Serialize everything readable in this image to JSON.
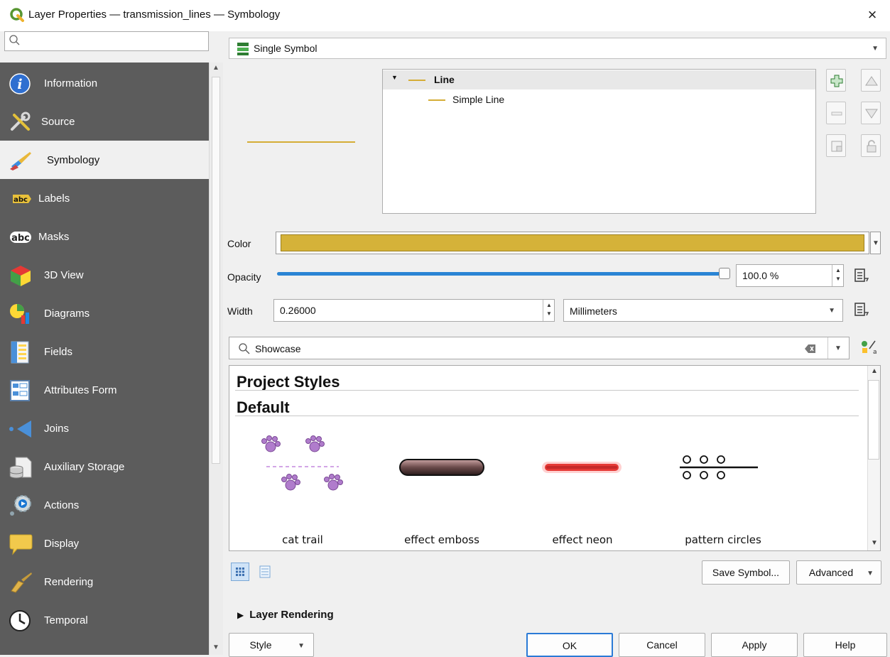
{
  "window": {
    "title": "Layer Properties — transmission_lines — Symbology",
    "close_glyph": "×"
  },
  "sidebar": {
    "search_placeholder": "",
    "items": [
      {
        "label": "Information",
        "icon": "information-icon"
      },
      {
        "label": "Source",
        "icon": "source-tools-icon"
      },
      {
        "label": "Symbology",
        "icon": "paintbrush-icon",
        "active": true
      },
      {
        "label": "Labels",
        "icon": "labels-abc-icon"
      },
      {
        "label": "Masks",
        "icon": "masks-abc-icon"
      },
      {
        "label": "3D View",
        "icon": "cube-3d-icon"
      },
      {
        "label": "Diagrams",
        "icon": "diagrams-icon"
      },
      {
        "label": "Fields",
        "icon": "fields-icon"
      },
      {
        "label": "Attributes Form",
        "icon": "attributes-form-icon"
      },
      {
        "label": "Joins",
        "icon": "joins-icon"
      },
      {
        "label": "Auxiliary Storage",
        "icon": "auxiliary-storage-icon"
      },
      {
        "label": "Actions",
        "icon": "actions-gear-icon"
      },
      {
        "label": "Display",
        "icon": "display-speech-bubble-icon"
      },
      {
        "label": "Rendering",
        "icon": "rendering-brush-icon"
      },
      {
        "label": "Temporal",
        "icon": "temporal-clock-icon"
      }
    ]
  },
  "renderer": {
    "selected": "Single Symbol"
  },
  "symbol_tree": {
    "root": "Line",
    "child": "Simple Line"
  },
  "form": {
    "color_label": "Color",
    "color_value": "#d5b239",
    "opacity_label": "Opacity",
    "opacity_value": "100.0 %",
    "opacity_fraction": 1.0,
    "width_label": "Width",
    "width_value": "0.26000",
    "width_units": "Millimeters"
  },
  "style_search": {
    "value": "Showcase"
  },
  "symbol_library": {
    "groups": [
      "Project Styles",
      "Default"
    ],
    "symbols": [
      {
        "label": "cat trail"
      },
      {
        "label": "effect emboss"
      },
      {
        "label": "effect neon"
      },
      {
        "label": "pattern circles"
      }
    ]
  },
  "actions": {
    "save_symbol": "Save Symbol...",
    "advanced": "Advanced"
  },
  "layer_rendering": {
    "label": "Layer Rendering"
  },
  "footer": {
    "style": "Style",
    "ok": "OK",
    "cancel": "Cancel",
    "apply": "Apply",
    "help": "Help"
  },
  "colors": {
    "accent_blue": "#2a84d4",
    "sidebar_bg": "#5c5c5c",
    "symbol_yellow": "#d5ad36"
  }
}
